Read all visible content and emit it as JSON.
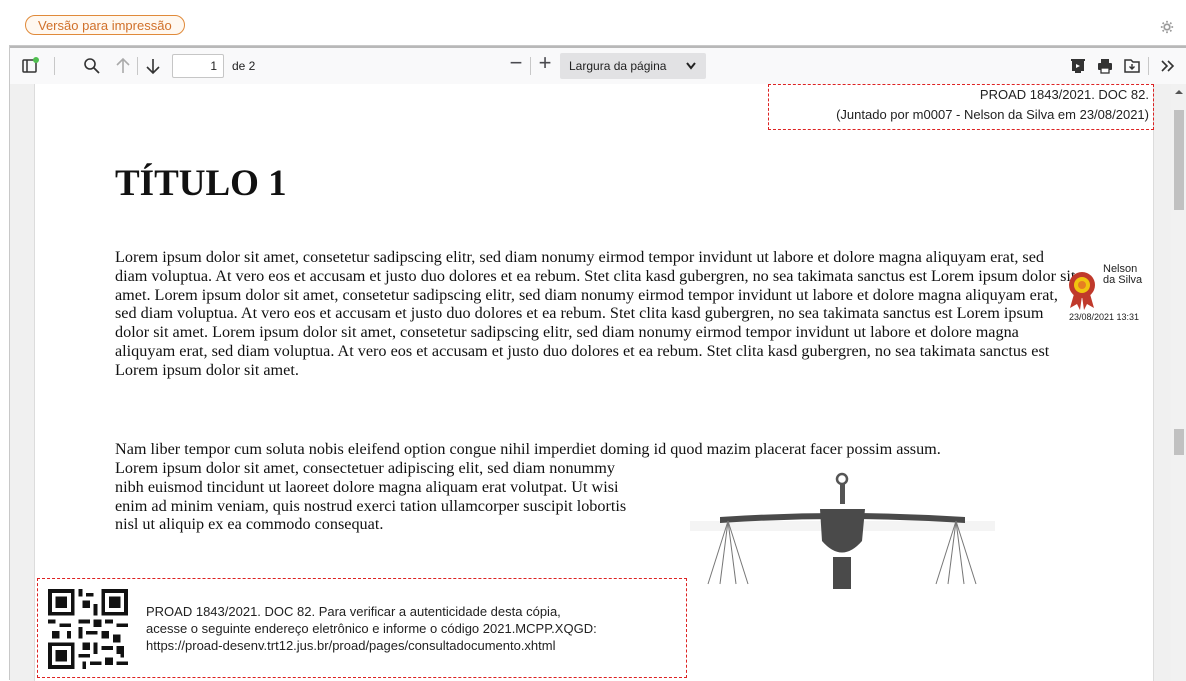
{
  "topbar": {
    "print_button": "Versão para impressão",
    "gear_icon": "gear-icon"
  },
  "toolbar": {
    "sidebar_icon": "sidebar-toggle-icon",
    "search_icon": "search-icon",
    "prev_icon": "arrow-up-icon",
    "next_icon": "arrow-down-icon",
    "page_number": "1",
    "page_of": "de 2",
    "zoom_out": "−",
    "zoom_in": "+",
    "zoom_value": "Largura da página",
    "presentation_icon": "presentation-icon",
    "print_icon": "print-icon",
    "save_icon": "save-icon",
    "more_icon": "double-chevron-right-icon"
  },
  "document": {
    "stamp_top_line1": "PROAD 1843/2021. DOC 82.",
    "stamp_top_line2": "(Juntado por m0007 - Nelson da Silva em 23/08/2021)",
    "title": "TÍTULO 1",
    "paragraph1": "Lorem ipsum dolor sit amet, consetetur sadipscing elitr, sed diam nonumy eirmod tempor invidunt ut labore et dolore magna aliquyam erat, sed diam voluptua. At vero eos et accusam et justo duo dolores et ea rebum. Stet clita kasd gubergren, no sea takimata sanctus est Lorem ipsum dolor sit amet. Lorem ipsum dolor sit amet, consetetur sadipscing elitr, sed diam nonumy eirmod tempor invidunt ut labore et dolore magna aliquyam erat, sed diam voluptua. At vero eos et accusam et justo duo dolores et ea rebum. Stet clita kasd gubergren, no sea takimata sanctus est Lorem ipsum dolor sit amet. Lorem ipsum dolor sit amet, consetetur sadipscing elitr, sed diam nonumy eirmod tempor invidunt ut labore et dolore magna aliquyam erat, sed diam voluptua. At vero eos et accusam et justo duo dolores et ea rebum. Stet clita kasd gubergren, no sea takimata sanctus est Lorem ipsum dolor sit amet.",
    "paragraph2": "Nam liber tempor cum soluta nobis eleifend option congue nihil imperdiet doming id quod mazim placerat facer possim assum.",
    "paragraph3": "Lorem ipsum dolor sit amet, consectetuer adipiscing elit, sed diam nonummy nibh euismod tincidunt ut laoreet dolore magna aliquam erat volutpat. Ut wisi enim ad minim veniam, quis nostrud exerci tation ullamcorper suscipit lobortis nisl ut aliquip ex ea commodo consequat.",
    "signature_name": "Nelson da Silva",
    "signature_date": "23/08/2021 13:31",
    "stamp_bottom_line1": "PROAD 1843/2021. DOC 82. Para verificar a autenticidade desta cópia,",
    "stamp_bottom_line2": "acesse o seguinte endereço eletrônico e informe o código 2021.MCPP.XQGD:",
    "stamp_bottom_line3": "https://proad-desenv.trt12.jus.br/proad/pages/consultadocumento.xhtml"
  },
  "colors": {
    "accent_orange": "#e08a3a",
    "stamp_red": "#dd2222"
  }
}
